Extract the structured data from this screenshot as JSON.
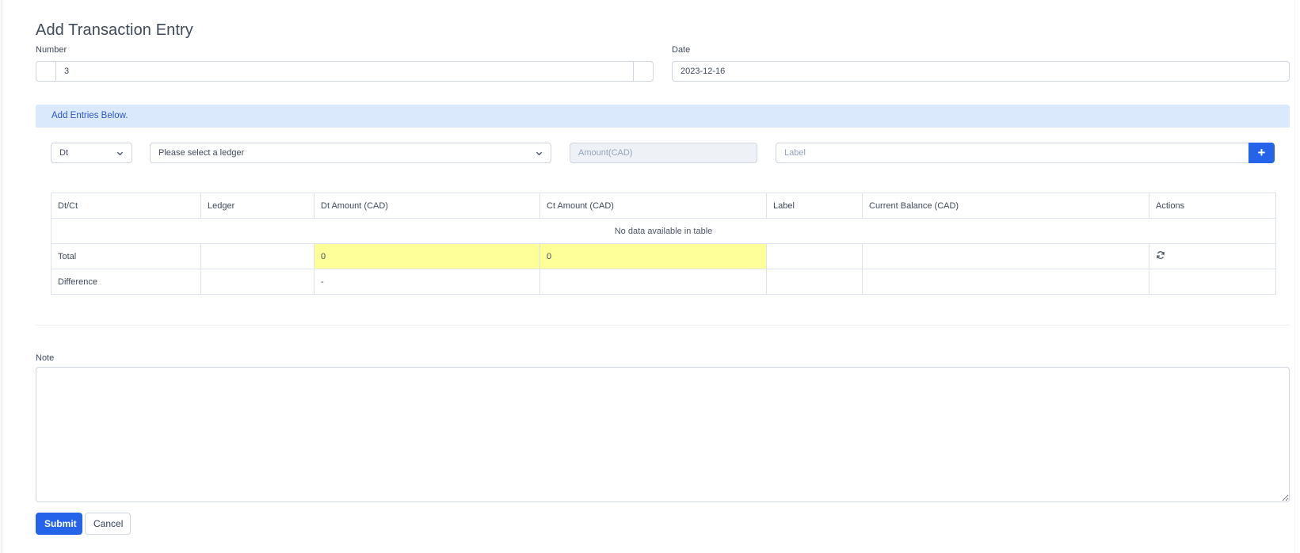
{
  "page": {
    "title": "Add Transaction Entry"
  },
  "form": {
    "number": {
      "label": "Number",
      "value": "3"
    },
    "date": {
      "label": "Date",
      "value": "2023-12-16"
    }
  },
  "entries": {
    "banner": "Add Entries Below.",
    "type_select": {
      "selected": "Dt"
    },
    "ledger_select": {
      "selected": "Please select a ledger"
    },
    "amount_input": {
      "placeholder": "Amount(CAD)",
      "value": ""
    },
    "label_input": {
      "placeholder": "Label",
      "value": ""
    },
    "add_button": {
      "icon": "plus-icon",
      "label": "+"
    }
  },
  "table": {
    "columns": [
      "Dt/Ct",
      "Ledger",
      "Dt Amount (CAD)",
      "Ct Amount (CAD)",
      "Label",
      "Current Balance (CAD)",
      "Actions"
    ],
    "empty_message": "No data available in table",
    "total_row": {
      "label": "Total",
      "ledger": "",
      "dt_amount": "0",
      "ct_amount": "0",
      "label_col": "",
      "balance": "",
      "action_icon": "refresh-icon"
    },
    "difference_row": {
      "label": "Difference",
      "ledger": "",
      "dt_amount": "-",
      "ct_amount": "",
      "label_col": "",
      "balance": "",
      "actions": ""
    },
    "highlight_color": "#ffff99"
  },
  "note": {
    "label": "Note",
    "value": ""
  },
  "actions": {
    "submit_label": "Submit",
    "cancel_label": "Cancel"
  },
  "colors": {
    "primary": "#2563eb",
    "banner_bg": "#dbe9fd",
    "banner_text": "#2b57c6"
  }
}
